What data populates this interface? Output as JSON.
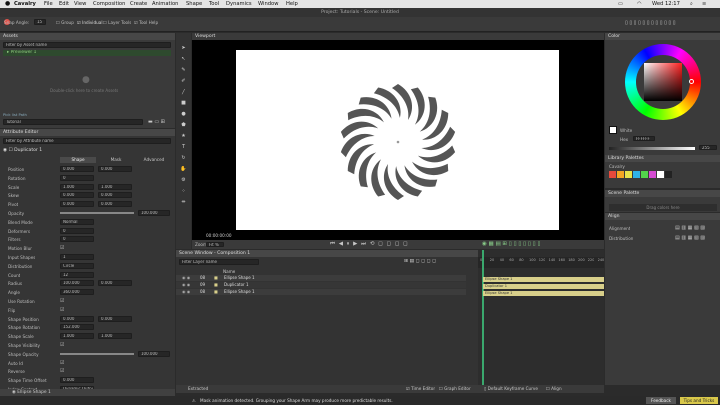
{
  "menubar": {
    "apple": "",
    "app": "Cavalry",
    "items": [
      "File",
      "Edit",
      "View",
      "Composition",
      "Create",
      "Animation",
      "Shape",
      "Tool",
      "Dynamics",
      "Window",
      "Help"
    ],
    "title": "Project: Tutorials - Scene: Untitled",
    "time": "Wed 12:17"
  },
  "toolbar": {
    "snap_label": "Snap Angle:",
    "snap_value": "15",
    "group": "Group",
    "individual": "Individual",
    "layer_tools": "Layer Tools",
    "tool_help": "Tool Help"
  },
  "assets": {
    "header": "Assets",
    "search_placeholder": "Filter by Asset name",
    "item": "Previewer 1",
    "empty_msg": "Double-click here to create Assets",
    "project_label": "Pick list Path",
    "project_value": "Tutorial"
  },
  "attr": {
    "header": "Attribute Editor",
    "search_placeholder": "Filter by Attribute name",
    "layer": "Duplicator 1",
    "col_shape": "Shape",
    "col_mask": "Mask",
    "col_advanced": "Advanced",
    "rows": [
      {
        "label": "Position",
        "v1": "0.000",
        "v2": "0.000"
      },
      {
        "label": "Rotation",
        "v1": "0",
        "v2": ""
      },
      {
        "label": "Scale",
        "v1": "1.000",
        "v2": "1.000"
      },
      {
        "label": "Skew",
        "v1": "0.000",
        "v2": "0.000"
      },
      {
        "label": "Pivot",
        "v1": "0.000",
        "v2": "0.000"
      },
      {
        "label": "Opacity",
        "v1": "100.000",
        "v2": ""
      },
      {
        "label": "Blend Mode",
        "v1": "Normal",
        "v2": ""
      },
      {
        "label": "Deformers",
        "v1": "0",
        "v2": ""
      },
      {
        "label": "Filters",
        "v1": "0",
        "v2": ""
      },
      {
        "label": "Motion Blur",
        "v1": "",
        "v2": ""
      },
      {
        "label": "Input Shapes",
        "v1": "1",
        "v2": ""
      },
      {
        "label": "Distribution",
        "v1": "Circle",
        "v2": ""
      },
      {
        "label": "Count",
        "v1": "12",
        "v2": ""
      },
      {
        "label": "Radius",
        "v1": "100.000",
        "v2": "0.000"
      },
      {
        "label": "Angle",
        "v1": "360.000",
        "v2": ""
      },
      {
        "label": "Use Rotation",
        "v1": "",
        "v2": ""
      },
      {
        "label": "Flip",
        "v1": "",
        "v2": ""
      },
      {
        "label": "Shape Position",
        "v1": "0.000",
        "v2": "0.000"
      },
      {
        "label": "Shape Rotation",
        "v1": "152.000",
        "v2": ""
      },
      {
        "label": "Shape Scale",
        "v1": "1.000",
        "v2": "1.000"
      },
      {
        "label": "Shape Visibility",
        "v1": "",
        "v2": ""
      },
      {
        "label": "Shape Opacity",
        "v1": "100.000",
        "v2": ""
      },
      {
        "label": "Auto Id",
        "v1": "",
        "v2": ""
      },
      {
        "label": "Reverse",
        "v1": "",
        "v2": ""
      },
      {
        "label": "Shape Time Offset",
        "v1": "0.000",
        "v2": ""
      },
      {
        "label": "Index Context",
        "v1": "Dynamic Output",
        "v2": ""
      }
    ],
    "bottom_layer": "Ellipse Shape 1",
    "bottom_tabs": [
      "Shape",
      "Fill",
      "Stroke",
      "Mask",
      "Advanced"
    ]
  },
  "viewport": {
    "header": "Viewport",
    "timecode": "00:00:00:00",
    "zoom_label": "Zoom",
    "zoom_value": "Fit %"
  },
  "scene": {
    "header": "Scene Window - Composition 1",
    "search_placeholder": "Filter Layer name",
    "col_name": "Name",
    "layers": [
      {
        "id": "08",
        "name": "Ellipse Shape 1"
      },
      {
        "id": "09",
        "name": "Duplicator 1"
      },
      {
        "id": "08",
        "name": "Ellipse Shape 1"
      }
    ],
    "ticks": [
      "0",
      "10",
      "20",
      "30",
      "40",
      "50",
      "60",
      "70",
      "80",
      "90",
      "100",
      "110",
      "120",
      "130",
      "140",
      "150",
      "160",
      "170",
      "180",
      "190",
      "200",
      "210",
      "220",
      "230",
      "240"
    ],
    "bar_labels": [
      "Ellipse Shape 1",
      "Duplicator 1",
      "Ellipse Shape 1"
    ],
    "footer_left": "Extracted",
    "time_editor": "Time Editor",
    "graph_editor": "Graph Editor",
    "keyframe_curve": "Default Keyframe Curve",
    "align": "Align"
  },
  "color": {
    "header": "Color",
    "swatch_label": "White",
    "hex_label": "Hex",
    "hex_value": "FFFFFF",
    "slider_value": "255",
    "library_header": "Library Palettes",
    "library_item": "Cavalry",
    "scene_header": "Scene Palette",
    "scene_msg": "Drag colors here",
    "palette": [
      "#e64a3c",
      "#f5a623",
      "#e8e34a",
      "#2fb3e8",
      "#52d44b",
      "#d54bd2",
      "#ffffff",
      "#222222"
    ]
  },
  "align": {
    "header": "Align",
    "alignment": "Alignment",
    "distribution": "Distribution"
  },
  "status": {
    "msg": "Mask animation detected. Grouping your Shape Arm may produce more predictable results.",
    "feedback": "Feedback",
    "tips": "Tips and Tricks"
  }
}
